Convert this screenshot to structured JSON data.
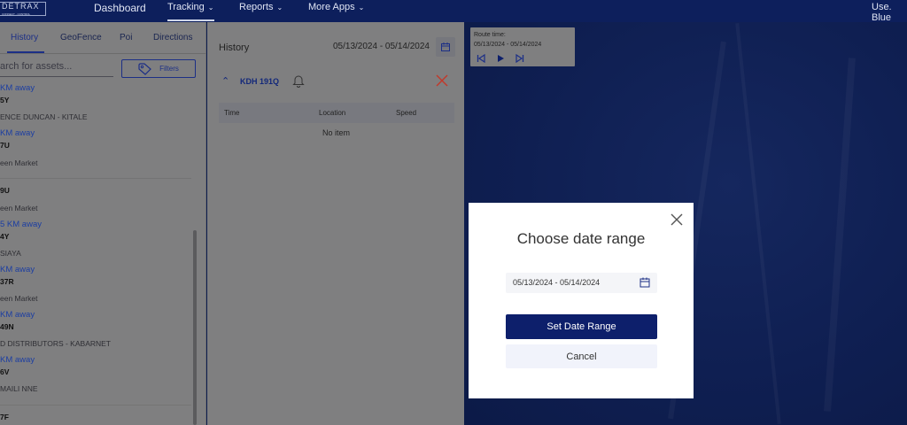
{
  "nav": {
    "logo_text": "DETRAX",
    "logo_sub": "CONNECT - CONTROL",
    "dashboard": "Dashboard",
    "tracking": "Tracking",
    "reports": "Reports",
    "more_apps": "More Apps",
    "user": "Use. Blue"
  },
  "left": {
    "tabs": [
      "History",
      "GeoFence",
      "Poi",
      "Directions"
    ],
    "search_placeholder": "arch for assets...",
    "filters_label": "Filters",
    "assets": [
      {
        "distance": " KM away",
        "plate": "5Y",
        "location": "ENCE DUNCAN - KITALE"
      },
      {
        "distance": " KM away",
        "plate": "7U",
        "location": "een Market"
      },
      {
        "distance": "",
        "plate": "9U",
        "location": "een Market"
      },
      {
        "distance": "5 KM away",
        "plate": "4Y",
        "location": "SIAYA"
      },
      {
        "distance": " KM away",
        "plate": "37R",
        "location": "een Market"
      },
      {
        "distance": " KM away",
        "plate": "49N",
        "location": "D DISTRIBUTORS - KABARNET"
      },
      {
        "distance": " KM away",
        "plate": "6V",
        "location": "MAILI NNE"
      },
      {
        "distance": "",
        "plate": "7F",
        "location": ""
      }
    ]
  },
  "history": {
    "title": "History",
    "date_range": "05/13/2024 - 05/14/2024",
    "vehicle_plate": "KDH 191Q",
    "columns": [
      "Time",
      "Location",
      "Speed"
    ],
    "empty_text": "No item"
  },
  "route": {
    "label": "Route time:",
    "dates": "05/13/2024 - 05/14/2024"
  },
  "modal": {
    "title": "Choose date range",
    "date_value": "05/13/2024 - 05/14/2024",
    "set_label": "Set Date Range",
    "cancel_label": "Cancel"
  },
  "colors": {
    "navy": "#0d1f5c",
    "primary_button": "#0d1f6b",
    "accent_blue": "#1c2f86",
    "close_red": "#c0392b"
  }
}
